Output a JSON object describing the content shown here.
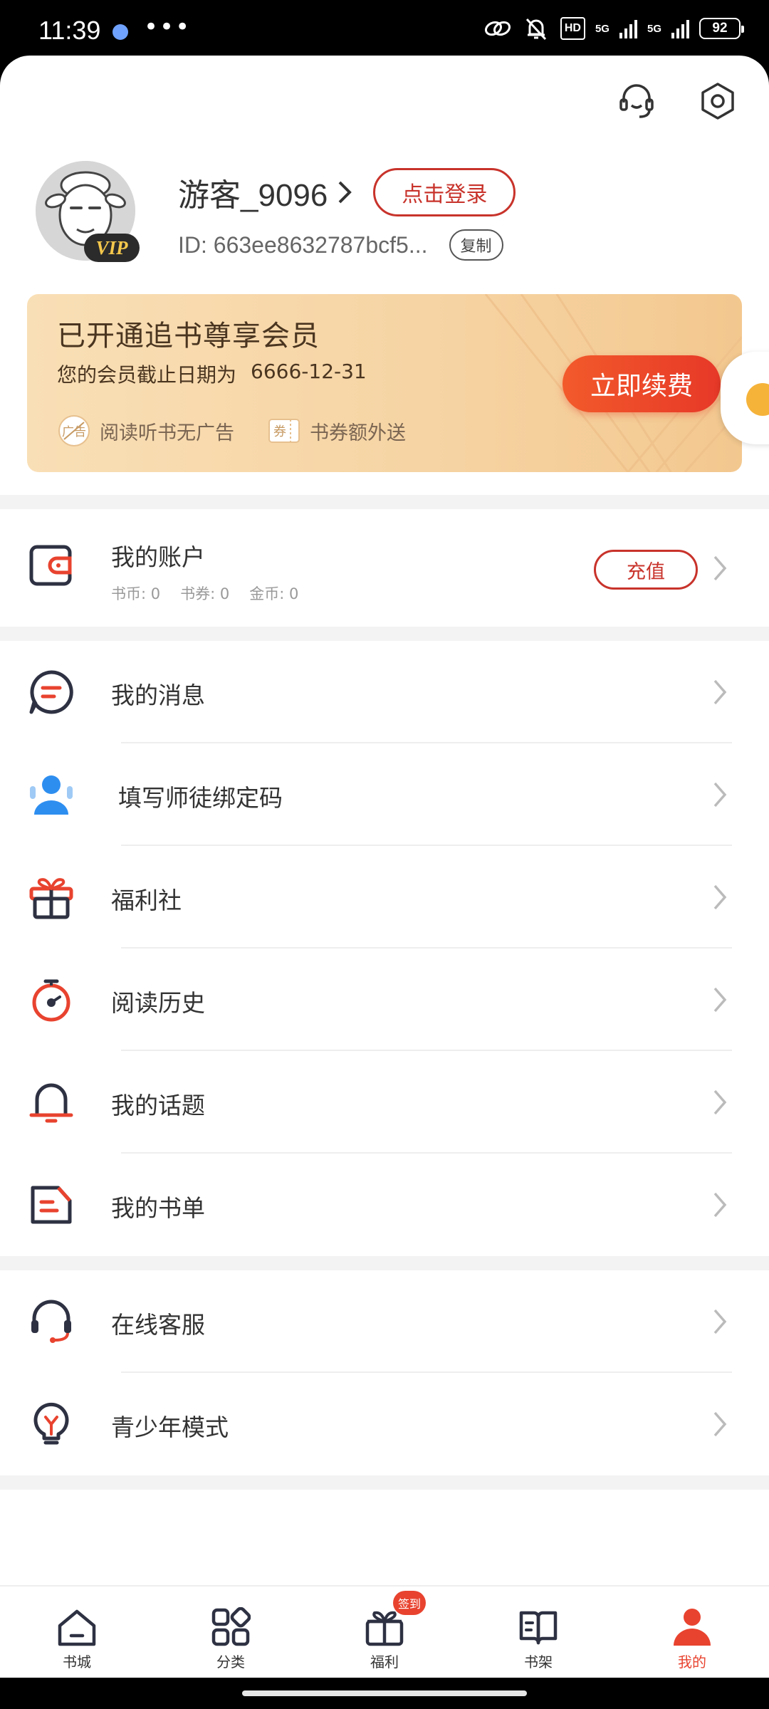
{
  "status_bar": {
    "time": "11:39",
    "dots": "•••",
    "hd": "HD",
    "net1": "5G",
    "net2": "5G",
    "battery": "92"
  },
  "profile": {
    "username": "游客_9096",
    "login_label": "点击登录",
    "id_text": "ID: 663ee8632787bcf5...",
    "copy_label": "复制",
    "vip_badge": "VIP"
  },
  "vip_card": {
    "title": "已开通追书尊享会员",
    "expire_label": "您的会员截止日期为",
    "expire_date": "6666-12-31",
    "renew_label": "立即续费",
    "benefits": [
      {
        "icon": "no-ad-icon",
        "icon_text": "广告",
        "label": "阅读听书无广告"
      },
      {
        "icon": "coupon-icon",
        "icon_text": "券",
        "label": "书券额外送"
      }
    ]
  },
  "account": {
    "label": "我的账户",
    "book_coin": "书币: 0",
    "book_coupon": "书券: 0",
    "gold_coin": "金币: 0",
    "recharge_label": "充值"
  },
  "menu_group1": [
    {
      "icon": "message-icon",
      "label": "我的消息"
    },
    {
      "icon": "mentor-icon",
      "label": "填写师徒绑定码"
    },
    {
      "icon": "gift-icon",
      "label": "福利社"
    },
    {
      "icon": "history-icon",
      "label": "阅读历史"
    },
    {
      "icon": "topic-bell-icon",
      "label": "我的话题"
    },
    {
      "icon": "booklist-icon",
      "label": "我的书单"
    }
  ],
  "menu_group2": [
    {
      "icon": "headset-icon",
      "label": "在线客服"
    },
    {
      "icon": "lightbulb-icon",
      "label": "青少年模式"
    }
  ],
  "bottom_nav": {
    "items": [
      {
        "label": "书城",
        "icon": "bookstore-icon"
      },
      {
        "label": "分类",
        "icon": "category-icon"
      },
      {
        "label": "福利",
        "icon": "welfare-gift-icon",
        "badge": "签到"
      },
      {
        "label": "书架",
        "icon": "bookshelf-icon"
      },
      {
        "label": "我的",
        "icon": "profile-icon",
        "active": true
      }
    ]
  },
  "colors": {
    "accent": "#e8432f",
    "login_border": "#c8332b",
    "vip_card": "#f6d3a2",
    "dark_icon": "#2d3142"
  }
}
